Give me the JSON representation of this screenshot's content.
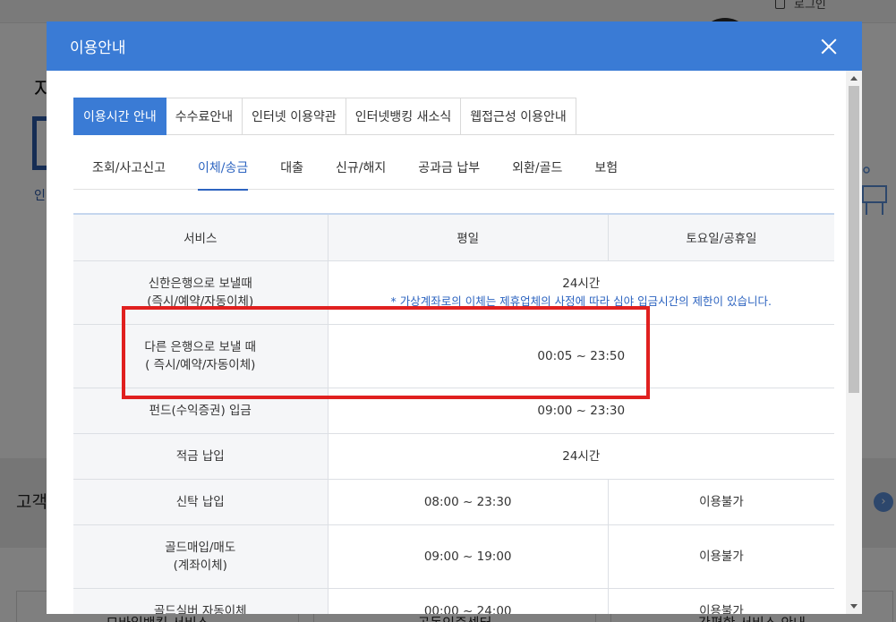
{
  "background": {
    "login_label": "로그인",
    "heading": "자",
    "small_text": "인",
    "service_heading": "고객",
    "arrow_glyph": "›",
    "tiles": [
      "모바일뱅킹 서비스",
      "공동인증센터",
      "간편한 서비스 안내"
    ]
  },
  "modal": {
    "title": "이용안내",
    "top_tabs": [
      "이용시간 안내",
      "수수료안내",
      "인터넷 이용약관",
      "인터넷뱅킹 새소식",
      "웹접근성 이용안내"
    ],
    "sub_tabs": [
      "조회/사고신고",
      "이체/송금",
      "대출",
      "신규/해지",
      "공과금 납부",
      "외환/골드",
      "보험"
    ],
    "table": {
      "headers": [
        "서비스",
        "평일",
        "토요일/공휴일"
      ],
      "rows": [
        {
          "service_l1": "신한은행으로 보낼때",
          "service_l2": "(즉시/예약/자동이체)",
          "value": "24시간",
          "note": "* 가상계좌로의 이체는 제휴업체의 사정에 따라 심야 입금시간의 제한이 있습니다."
        },
        {
          "service_l1": "다른 은행으로 보낼 때",
          "service_l2": "( 즉시/예약/자동이체)",
          "value": "00:05 ~ 23:50"
        },
        {
          "service_l1": "펀드(수익증권) 입금",
          "value": "09:00 ~ 23:30"
        },
        {
          "service_l1": "적금 납입",
          "value": "24시간"
        },
        {
          "service_l1": "신탁 납입",
          "weekday": "08:00 ~ 23:30",
          "weekend": "이용불가"
        },
        {
          "service_l1": "골드매입/매도",
          "service_l2": "(계좌이체)",
          "weekday": "09:00 ~ 19:00",
          "weekend": "이용불가"
        },
        {
          "service_l1": "골드실버 자동이체",
          "weekday": "00:00 ~ 24:00",
          "weekend": "이용불가"
        }
      ]
    }
  },
  "colors": {
    "header_blue": "#3a7bd5",
    "highlight_red": "#e0201f",
    "note_blue": "#2d64c0"
  }
}
